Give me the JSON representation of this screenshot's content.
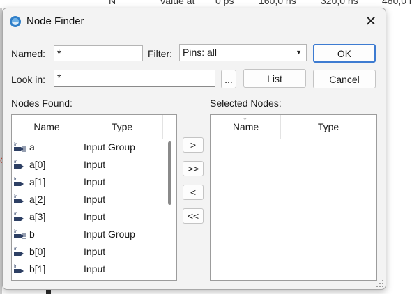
{
  "background": {
    "header_labels": [
      "N",
      "Value at",
      "0 ps",
      "160,0 ns",
      "320,0 ns",
      "480,0 n"
    ]
  },
  "dialog": {
    "title": "Node Finder",
    "named_label": "Named:",
    "named_value": "*",
    "filter_label": "Filter:",
    "filter_value": "Pins: all",
    "ok_label": "OK",
    "lookin_label": "Look in:",
    "lookin_value": "*",
    "browse_label": "...",
    "list_label": "List",
    "cancel_label": "Cancel",
    "nodes_found_label": "Nodes Found:",
    "selected_nodes_label": "Selected Nodes:",
    "columns": {
      "name": "Name",
      "type": "Type"
    },
    "move_buttons": {
      "add_one": ">",
      "add_all": ">>",
      "remove_one": "<",
      "remove_all": "<<"
    },
    "nodes_found": [
      {
        "name": "a",
        "type": "Input Group",
        "icon": "input-group-icon"
      },
      {
        "name": "a[0]",
        "type": "Input",
        "icon": "input-pin-icon"
      },
      {
        "name": "a[1]",
        "type": "Input",
        "icon": "input-pin-icon"
      },
      {
        "name": "a[2]",
        "type": "Input",
        "icon": "input-pin-icon"
      },
      {
        "name": "a[3]",
        "type": "Input",
        "icon": "input-pin-icon"
      },
      {
        "name": "b",
        "type": "Input Group",
        "icon": "input-group-icon"
      },
      {
        "name": "b[0]",
        "type": "Input",
        "icon": "input-pin-icon"
      },
      {
        "name": "b[1]",
        "type": "Input",
        "icon": "input-pin-icon"
      }
    ],
    "selected_nodes": []
  },
  "colors": {
    "accent": "#3d7bd1",
    "pin_icon": "#2d3f63"
  }
}
